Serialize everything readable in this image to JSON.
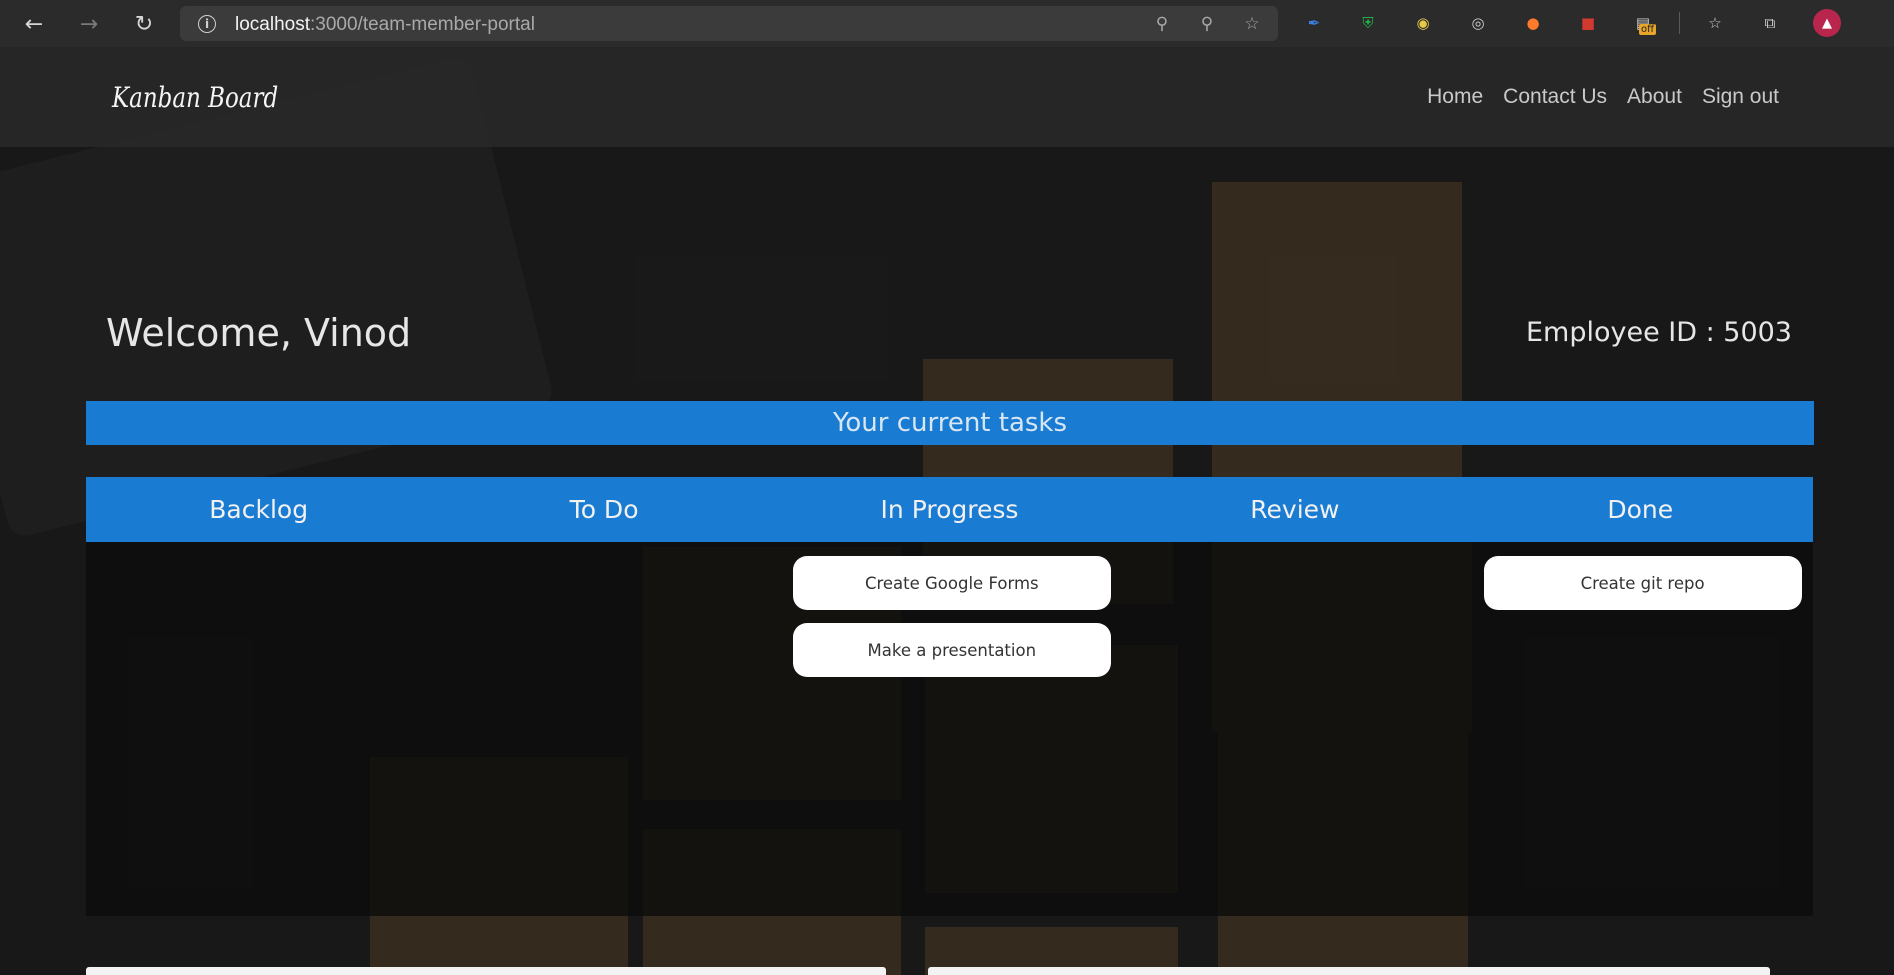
{
  "browser": {
    "url_host": "localhost",
    "url_path": ":3000/team-member-portal",
    "extensions": [
      "pen-extension-icon",
      "shield-extension-icon",
      "color-picker-extension-icon",
      "target-extension-icon",
      "dot-extension-icon",
      "book-extension-icon",
      "off-extension-icon"
    ],
    "off_badge": "off"
  },
  "navbar": {
    "brand": "Kanban Board",
    "links": [
      "Home",
      "Contact Us",
      "About",
      "Sign out"
    ]
  },
  "welcome": {
    "greeting": "Welcome, Vinod",
    "employee_id": "Employee ID : 5003"
  },
  "tasks_header": "Your current tasks",
  "board": {
    "columns": [
      {
        "title": "Backlog",
        "tasks": []
      },
      {
        "title": "To Do",
        "tasks": []
      },
      {
        "title": "In Progress",
        "tasks": [
          "Create Google Forms",
          "Make a presentation"
        ]
      },
      {
        "title": "Review",
        "tasks": []
      },
      {
        "title": "Done",
        "tasks": [
          "Create git repo"
        ]
      }
    ]
  },
  "colors": {
    "accent": "#1a7bd2",
    "card": "#ffffff"
  }
}
